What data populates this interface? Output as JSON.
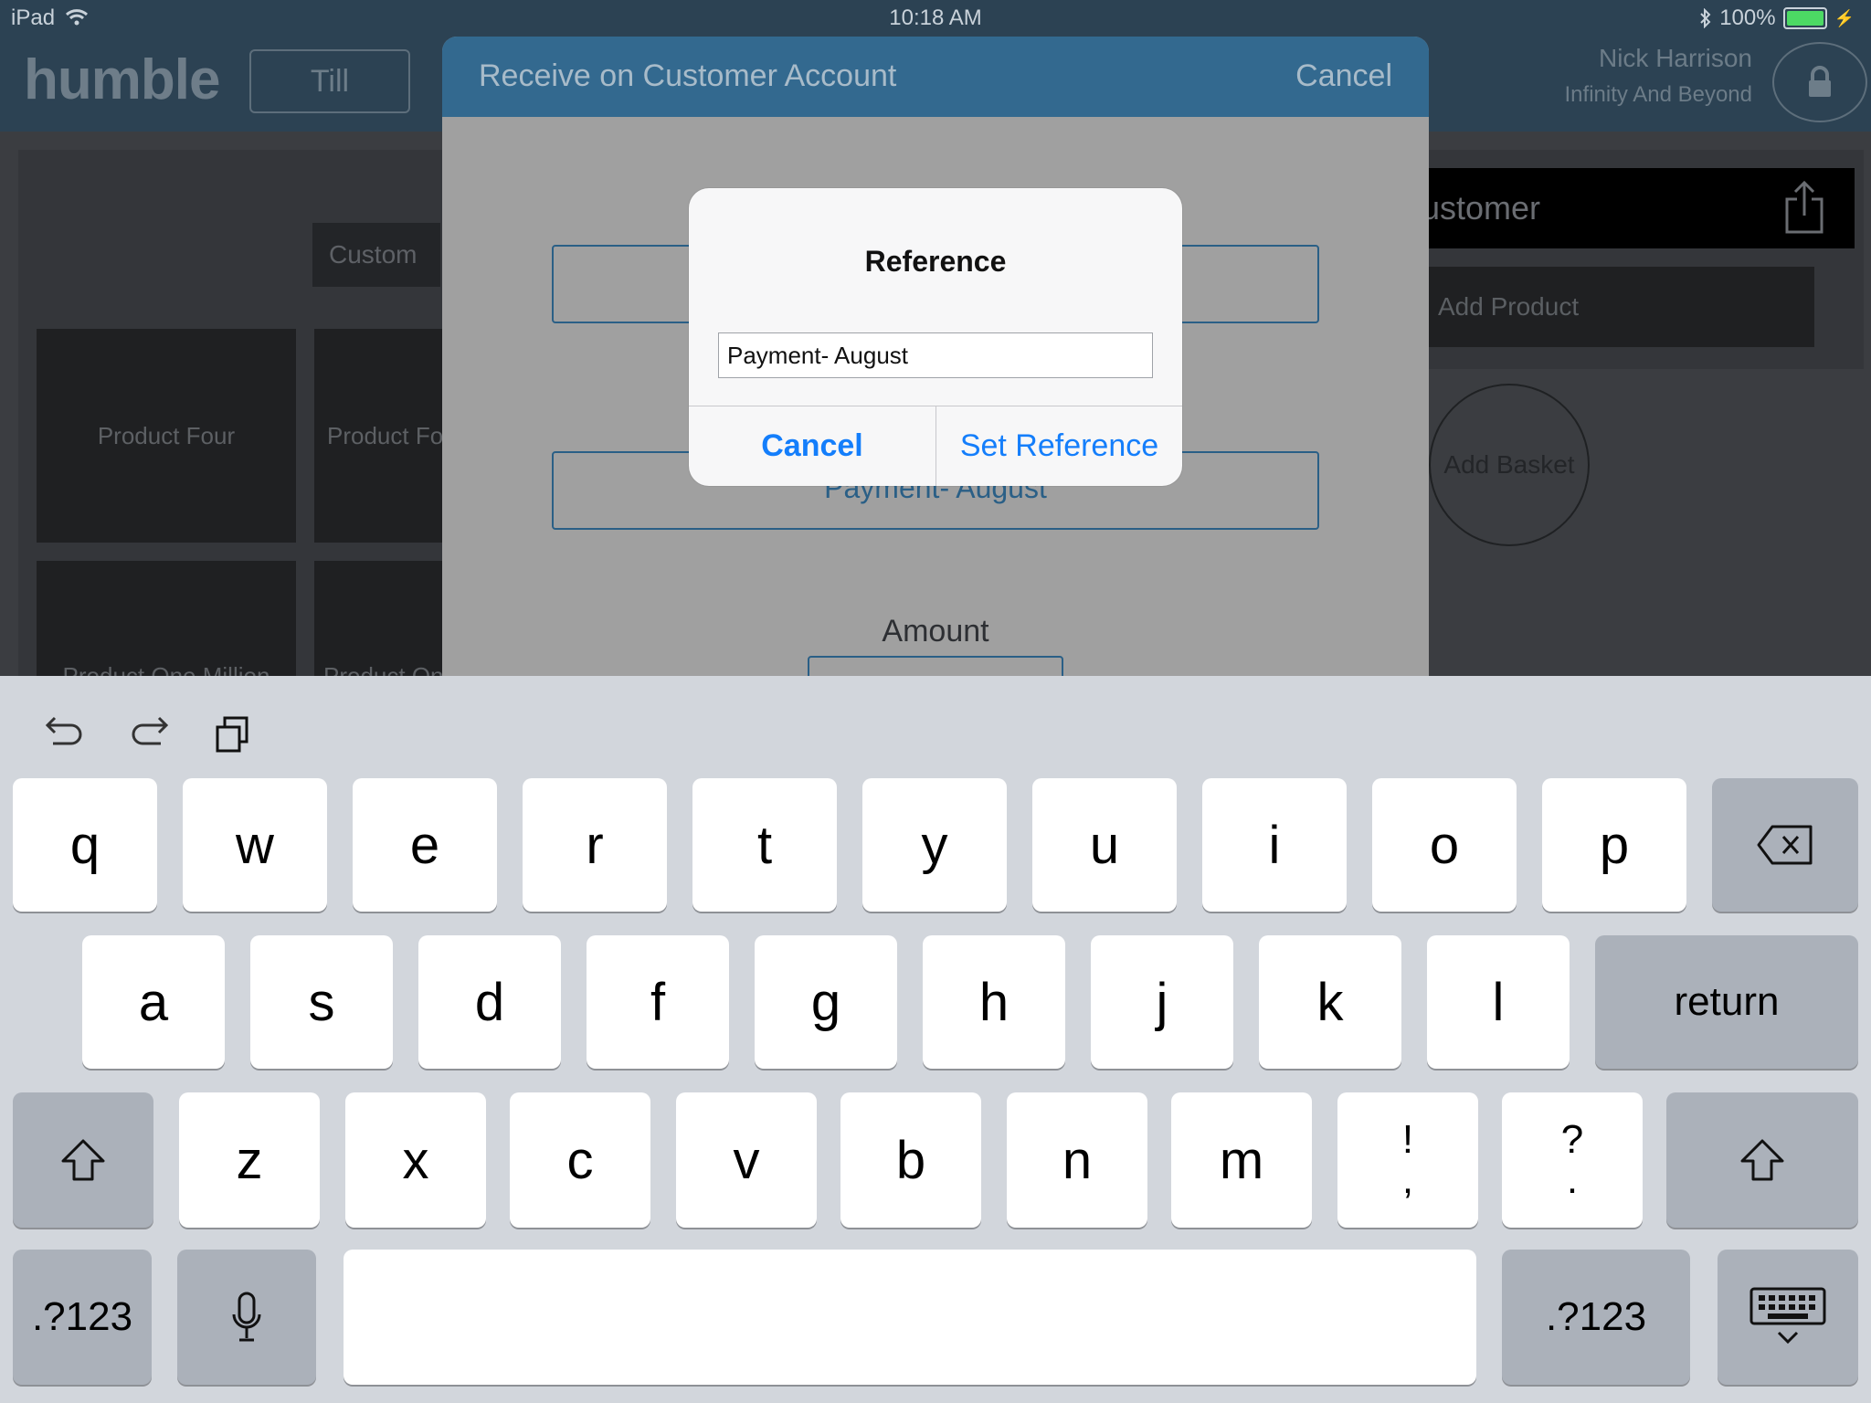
{
  "status_bar": {
    "device": "iPad",
    "time": "10:18 AM",
    "battery": "100%"
  },
  "header": {
    "logo": "humble",
    "till_label": "Till",
    "user_name": "Nick Harrison",
    "user_company": "Infinity And Beyond"
  },
  "background": {
    "custom_tab": "Custom",
    "products": [
      "Product Four",
      "Product Fo",
      "Product One Million",
      "Product On"
    ],
    "customer_label": "Customer",
    "add_product": "Add Product",
    "add_basket": "Add Basket"
  },
  "modal": {
    "title": "Receive on Customer Account",
    "cancel": "Cancel",
    "reference_value": "Payment- August",
    "amount_label": "Amount"
  },
  "alert": {
    "title": "Reference",
    "input_value": "Payment- August",
    "cancel": "Cancel",
    "confirm": "Set Reference"
  },
  "keyboard": {
    "row1": [
      "q",
      "w",
      "e",
      "r",
      "t",
      "y",
      "u",
      "i",
      "o",
      "p"
    ],
    "row2": [
      "a",
      "s",
      "d",
      "f",
      "g",
      "h",
      "j",
      "k",
      "l"
    ],
    "row3": [
      "z",
      "x",
      "c",
      "v",
      "b",
      "n",
      "m"
    ],
    "punct1": [
      "!",
      ","
    ],
    "punct2": [
      "?",
      "."
    ],
    "return_label": "return",
    "numbers_label": ".?123"
  }
}
